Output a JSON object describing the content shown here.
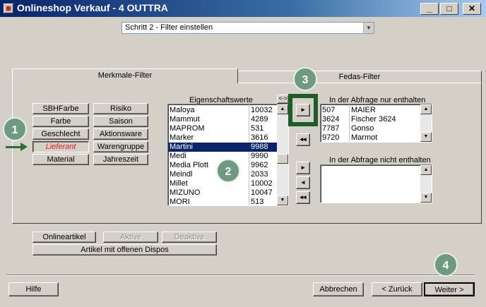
{
  "window": {
    "title": "Onlineshop Verkauf - 4 OUTTRA",
    "controls": {
      "minimize": "_",
      "maximize": "□",
      "close": "✕"
    }
  },
  "step_select": {
    "value": "Schritt 2 - Filter einstellen"
  },
  "tabs": [
    {
      "label": "Merkmale-Filter",
      "active": true
    },
    {
      "label": "Fedas-Filter",
      "active": false
    }
  ],
  "attribute_buttons": [
    {
      "label": "SBHFarbe"
    },
    {
      "label": "Risiko"
    },
    {
      "label": "Farbe"
    },
    {
      "label": "Saison"
    },
    {
      "label": "Geschlecht"
    },
    {
      "label": "Aktionsware"
    },
    {
      "label": "Lieferant",
      "selected": true
    },
    {
      "label": "Warengruppe"
    },
    {
      "label": "Material"
    },
    {
      "label": "Jahreszeit"
    }
  ],
  "property_values": {
    "header": "Eigenschaftswerte",
    "toggle_label": "<->",
    "rows": [
      {
        "name": "Maloya",
        "code": "10032"
      },
      {
        "name": "Mammut",
        "code": "4289"
      },
      {
        "name": "MAPROM",
        "code": "531"
      },
      {
        "name": "Marker",
        "code": "3616"
      },
      {
        "name": "Martini",
        "code": "9988",
        "selected": true
      },
      {
        "name": "Medi",
        "code": "9990"
      },
      {
        "name": "Media Plott",
        "code": "9962"
      },
      {
        "name": "Meindl",
        "code": "2033"
      },
      {
        "name": "Millet",
        "code": "10002"
      },
      {
        "name": "MIZUNO",
        "code": "10047"
      },
      {
        "name": "MORI",
        "code": "513"
      }
    ]
  },
  "include_list": {
    "header": "In der Abfrage nur enthalten",
    "rows": [
      {
        "code": "507",
        "name": "MAIER"
      },
      {
        "code": "3624",
        "name": "Fischer 3624"
      },
      {
        "code": "7787",
        "name": "Gonso"
      },
      {
        "code": "9720",
        "name": "Marmot"
      }
    ]
  },
  "exclude_list": {
    "header": "In der Abfrage nicht enthalten",
    "rows": []
  },
  "transfer_buttons": {
    "add_include": "▸",
    "remove_include": "◂◂",
    "add_exclude": "▸",
    "remove_exclude": "◂",
    "remove_all_exclude": "◂◂"
  },
  "lower_buttons": {
    "onlineartikel": "Onlineartikel",
    "aktive": "Aktive",
    "deaktive": "Deaktive",
    "offene_dispos": "Artikel mit offenen Dispos"
  },
  "footer": {
    "help": "Hilfe",
    "cancel": "Abbrechen",
    "back": "< Zurück",
    "next": "Weiter >"
  },
  "annotations": {
    "badges": [
      "1",
      "2",
      "3",
      "4"
    ],
    "color_badge": "#6f9a80",
    "color_highlight": "#1f5c2a"
  },
  "colors": {
    "selection": "#0a246a",
    "dialog_bg": "#d4d0c8"
  }
}
